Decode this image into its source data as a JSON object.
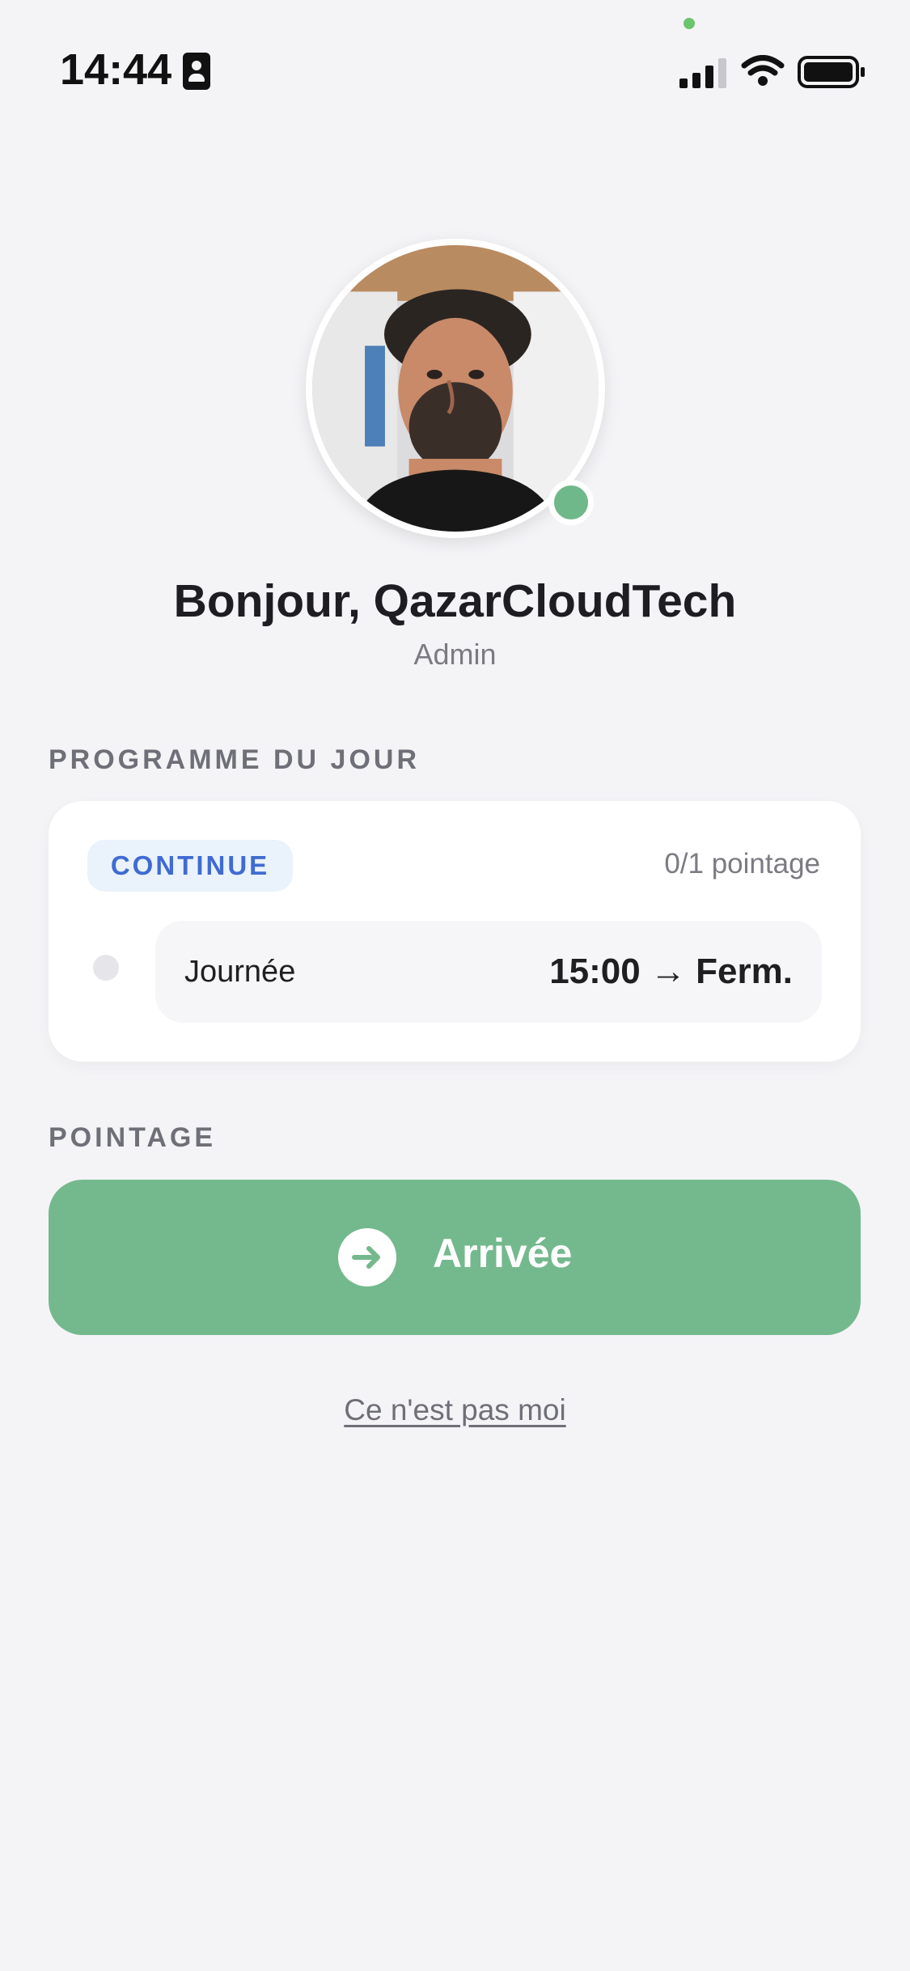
{
  "status_bar": {
    "time": "14:44",
    "icons": {
      "contact": "contact-card-icon",
      "signal": "cellular-signal-icon",
      "wifi": "wifi-icon",
      "battery": "battery-icon"
    },
    "privacy_indicator_color": "#6cc46c"
  },
  "profile": {
    "greeting": "Bonjour, QazarCloudTech",
    "role": "Admin",
    "avatar": "user-photo",
    "online_status_color": "#6fb889"
  },
  "schedule": {
    "section_label": "PROGRAMME DU JOUR",
    "badge": "CONTINUE",
    "badge_color": "#3f6bd2",
    "pointage_count": "0/1 pointage",
    "shifts": [
      {
        "name": "Journée",
        "time": "15:00 → Ferm."
      }
    ]
  },
  "pointage": {
    "section_label": "POINTAGE",
    "button_label": "Arrivée",
    "button_icon": "arrow-right-circle-icon",
    "button_color": "#74b98d"
  },
  "footer": {
    "not_me_link": "Ce n'est pas moi"
  }
}
